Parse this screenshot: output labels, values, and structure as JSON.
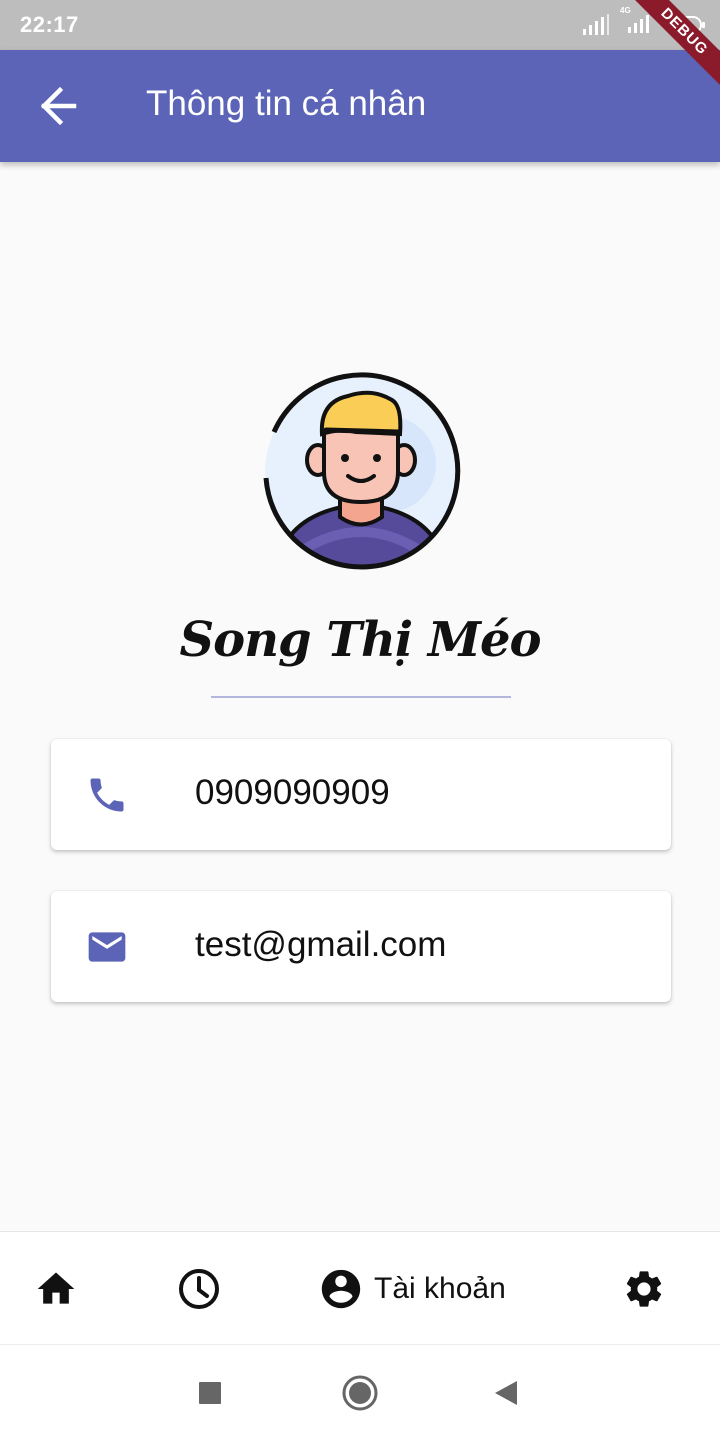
{
  "status_bar": {
    "time": "22:17",
    "network_label": "4G",
    "battery": "62",
    "debug_label": "DEBUG"
  },
  "app_bar": {
    "title": "Thông tin cá nhân",
    "back_icon": "arrow-back-icon",
    "background_color": "#5c64b7"
  },
  "profile": {
    "name": "Song Thị Méo",
    "avatar_icon": "avatar-icon"
  },
  "info_cards": [
    {
      "icon": "phone-icon",
      "value": "0909090909"
    },
    {
      "icon": "email-icon",
      "value": "test@gmail.com"
    }
  ],
  "bottom_nav": {
    "items": [
      {
        "icon": "home-icon",
        "label": ""
      },
      {
        "icon": "history-icon",
        "label": ""
      },
      {
        "icon": "account-icon",
        "label": "Tài khoản",
        "active": true
      },
      {
        "icon": "settings-icon",
        "label": ""
      }
    ]
  },
  "system_nav": {
    "items": [
      "recent-apps-icon",
      "home-circle-icon",
      "back-triangle-icon"
    ]
  },
  "colors": {
    "accent": "#5c64b7",
    "background": "#fafafa",
    "divider": "#b3b7de"
  }
}
